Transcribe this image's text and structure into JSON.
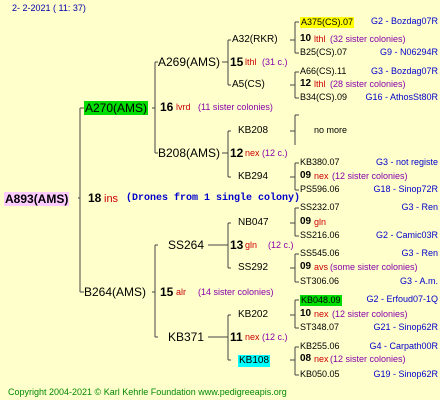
{
  "header": {
    "date": "2-  2-2021 ( 11: 37)"
  },
  "footer": {
    "copyright": "Copyright 2004-2021 © Karl Kehrle Foundation   www.pedigreeapis.org"
  },
  "root": {
    "name": "A893(AMS)",
    "age": "18",
    "note": "ins",
    "drones": "(Drones from 1 single colony)"
  },
  "gen1": [
    {
      "name": "A270(AMS)",
      "age": "16",
      "note": "lvrd",
      "info": "(11 sister colonies)"
    },
    {
      "name": "B264(AMS)",
      "age": "15",
      "note": "alr",
      "info": "(14 sister colonies)"
    }
  ],
  "gen2": [
    {
      "name": "A269(AMS)",
      "age": "15",
      "note": "lthl",
      "info": "(31 c.)"
    },
    {
      "name": "B208(AMS)",
      "age": "12",
      "note": "nex",
      "info": "(12 c.)"
    },
    {
      "name": "SS264",
      "age": "13",
      "note": "gln",
      "info": "(12 c.)"
    },
    {
      "name": "KB371",
      "age": "11",
      "note": "nex",
      "info": "(12 c.)"
    }
  ],
  "gen3": [
    {
      "name": "A32(RKR)",
      "age": "10",
      "note": "lthl",
      "info": "(32 sister colonies)"
    },
    {
      "name": "A5(CS)",
      "age": "12",
      "note": "lthl",
      "info": "(28 sister colonies)"
    },
    {
      "name": "KB208",
      "age": "",
      "note": "",
      "info": "no more"
    },
    {
      "name": "KB294",
      "age": "09",
      "note": "nex",
      "info": "(12 sister colonies)"
    },
    {
      "name": "NB047",
      "age": "09",
      "note": "gln",
      "info": ""
    },
    {
      "name": "SS292",
      "age": "09",
      "note": "avs",
      "info": "(some sister colonies)"
    },
    {
      "name": "KB202",
      "age": "10",
      "note": "nex",
      "info": "(12 sister colonies)"
    },
    {
      "name": "KB108",
      "age": "08",
      "note": "nex",
      "info": "(12 sister colonies)"
    }
  ],
  "gen4": [
    {
      "name": "A375(CS).07",
      "info": "G2 - Bozdag07R"
    },
    {
      "name": "B25(CS).07",
      "info": "G9 - N06294R"
    },
    {
      "name": "A66(CS).11",
      "info": "G3 - Bozdag07R"
    },
    {
      "name": "B34(CS).09",
      "info": "G16 - AthosSt80R"
    },
    {
      "name": "KB380.07",
      "info": "G3 - not registe"
    },
    {
      "name": "PS596.06",
      "info": "G18 - Sinop72R"
    },
    {
      "name": "SS232.07",
      "info": "G3 - Ren"
    },
    {
      "name": "SS216.06",
      "info": "G2 - Camic03R"
    },
    {
      "name": "SS545.06",
      "info": "G3 - Ren"
    },
    {
      "name": "ST306.06",
      "info": "G3 - A.m."
    },
    {
      "name": "KB048.09",
      "info": "G2 - Erfoud07-1Q"
    },
    {
      "name": "ST348.07",
      "info": "G21 - Sinop62R"
    },
    {
      "name": "KB255.06",
      "info": "G4 - Carpath00R"
    },
    {
      "name": "KB050.05",
      "info": "G19 - Sinop62R"
    }
  ]
}
